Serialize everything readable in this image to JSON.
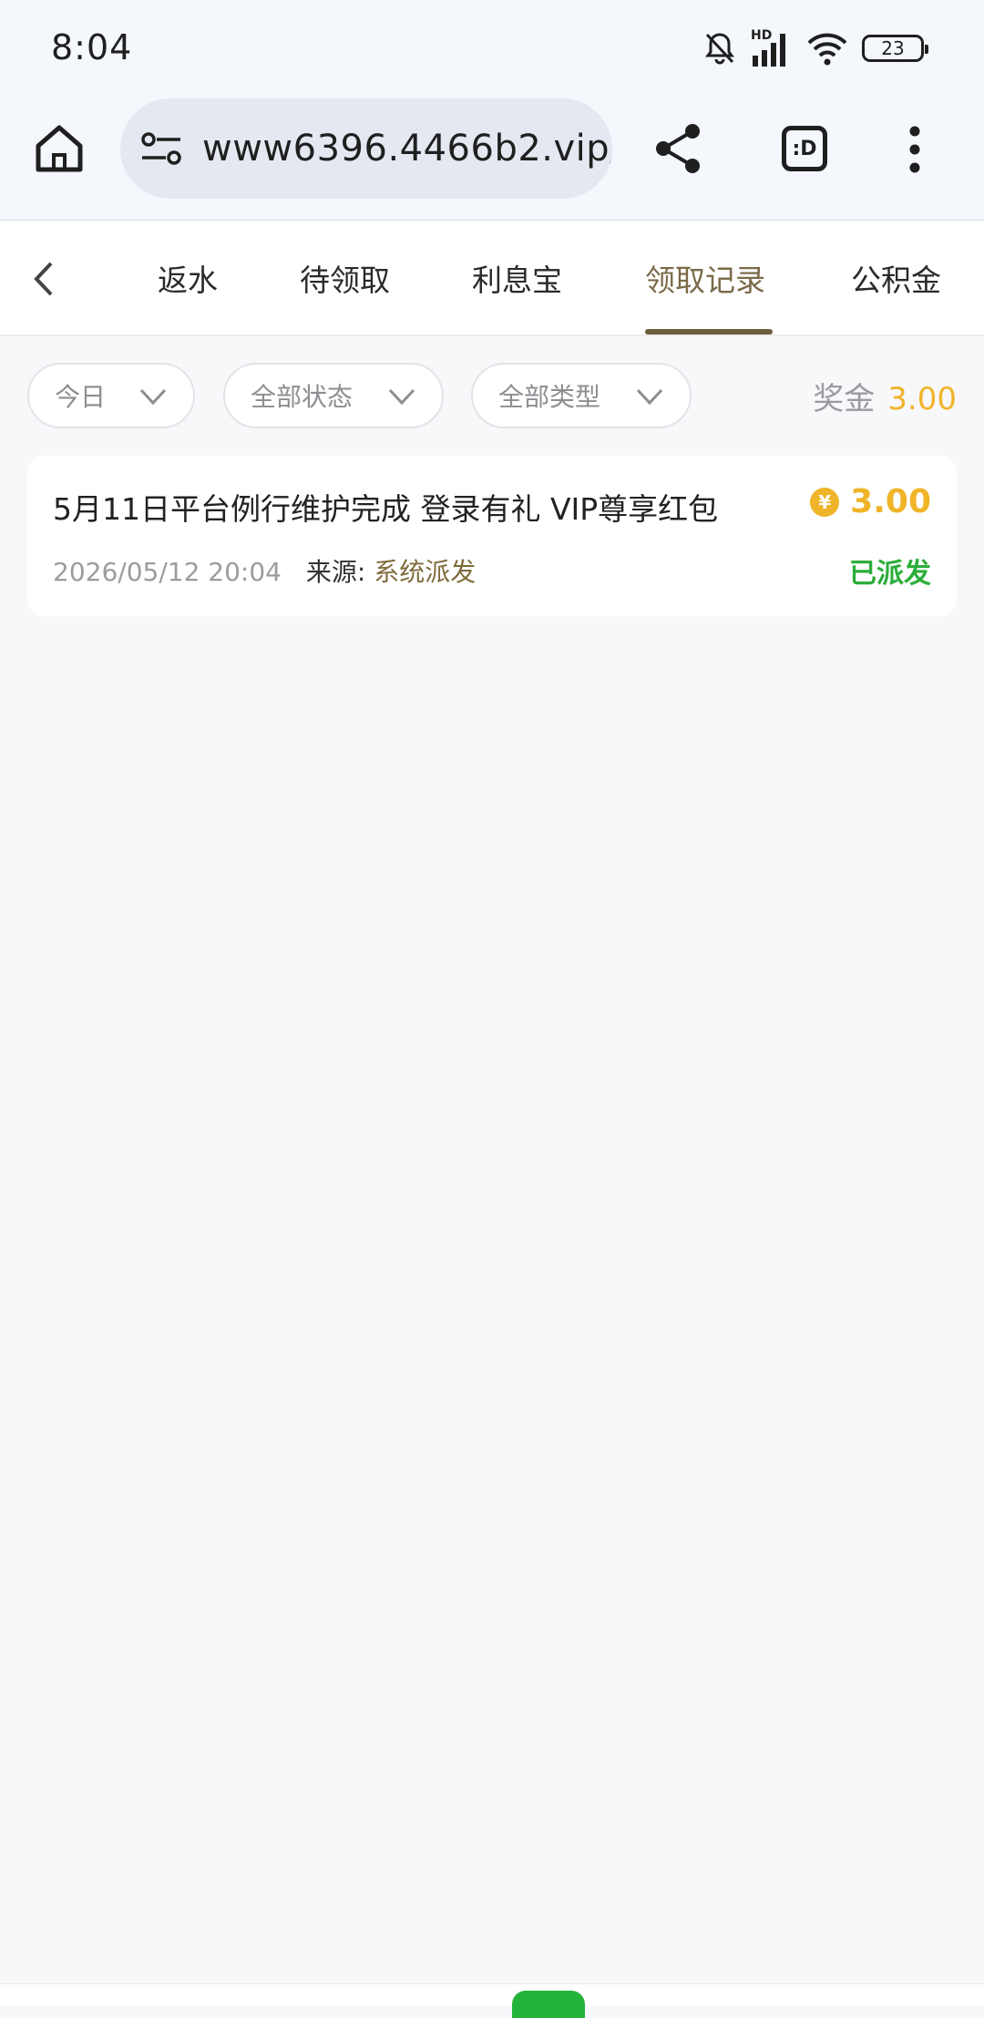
{
  "status_bar": {
    "time": "8:04",
    "hd_label": "HD",
    "battery": "23",
    "icons": [
      "bell-muted-icon",
      "signal-icon",
      "wifi-icon",
      "battery-icon"
    ]
  },
  "browser": {
    "url": "www6396.4466b2.vip/",
    "tabs_label": ":D",
    "icons": [
      "home-icon",
      "tune-icon",
      "share-icon",
      "tabs-icon",
      "more-vert-icon"
    ]
  },
  "nav": {
    "tabs": [
      {
        "label": "返水"
      },
      {
        "label": "待领取"
      },
      {
        "label": "利息宝"
      },
      {
        "label": "领取记录",
        "active": true
      },
      {
        "label": "公积金"
      }
    ],
    "accent_color": "#6d5e3e"
  },
  "filters": {
    "date": "今日",
    "status": "全部状态",
    "type": "全部类型",
    "bonus_label": "奖金",
    "bonus_amount": "3.00"
  },
  "records": [
    {
      "title": "5月11日平台例行维护完成 登录有礼 VIP尊享红包",
      "amount": "3.00",
      "coin_symbol": "¥",
      "datetime": "2026/05/12 20:04",
      "source_label": "来源:",
      "source_value": "系统派发",
      "status": "已派发"
    }
  ],
  "colors": {
    "gold": "#f0b429",
    "success": "#2cae3a",
    "source": "#7f6b3a"
  }
}
